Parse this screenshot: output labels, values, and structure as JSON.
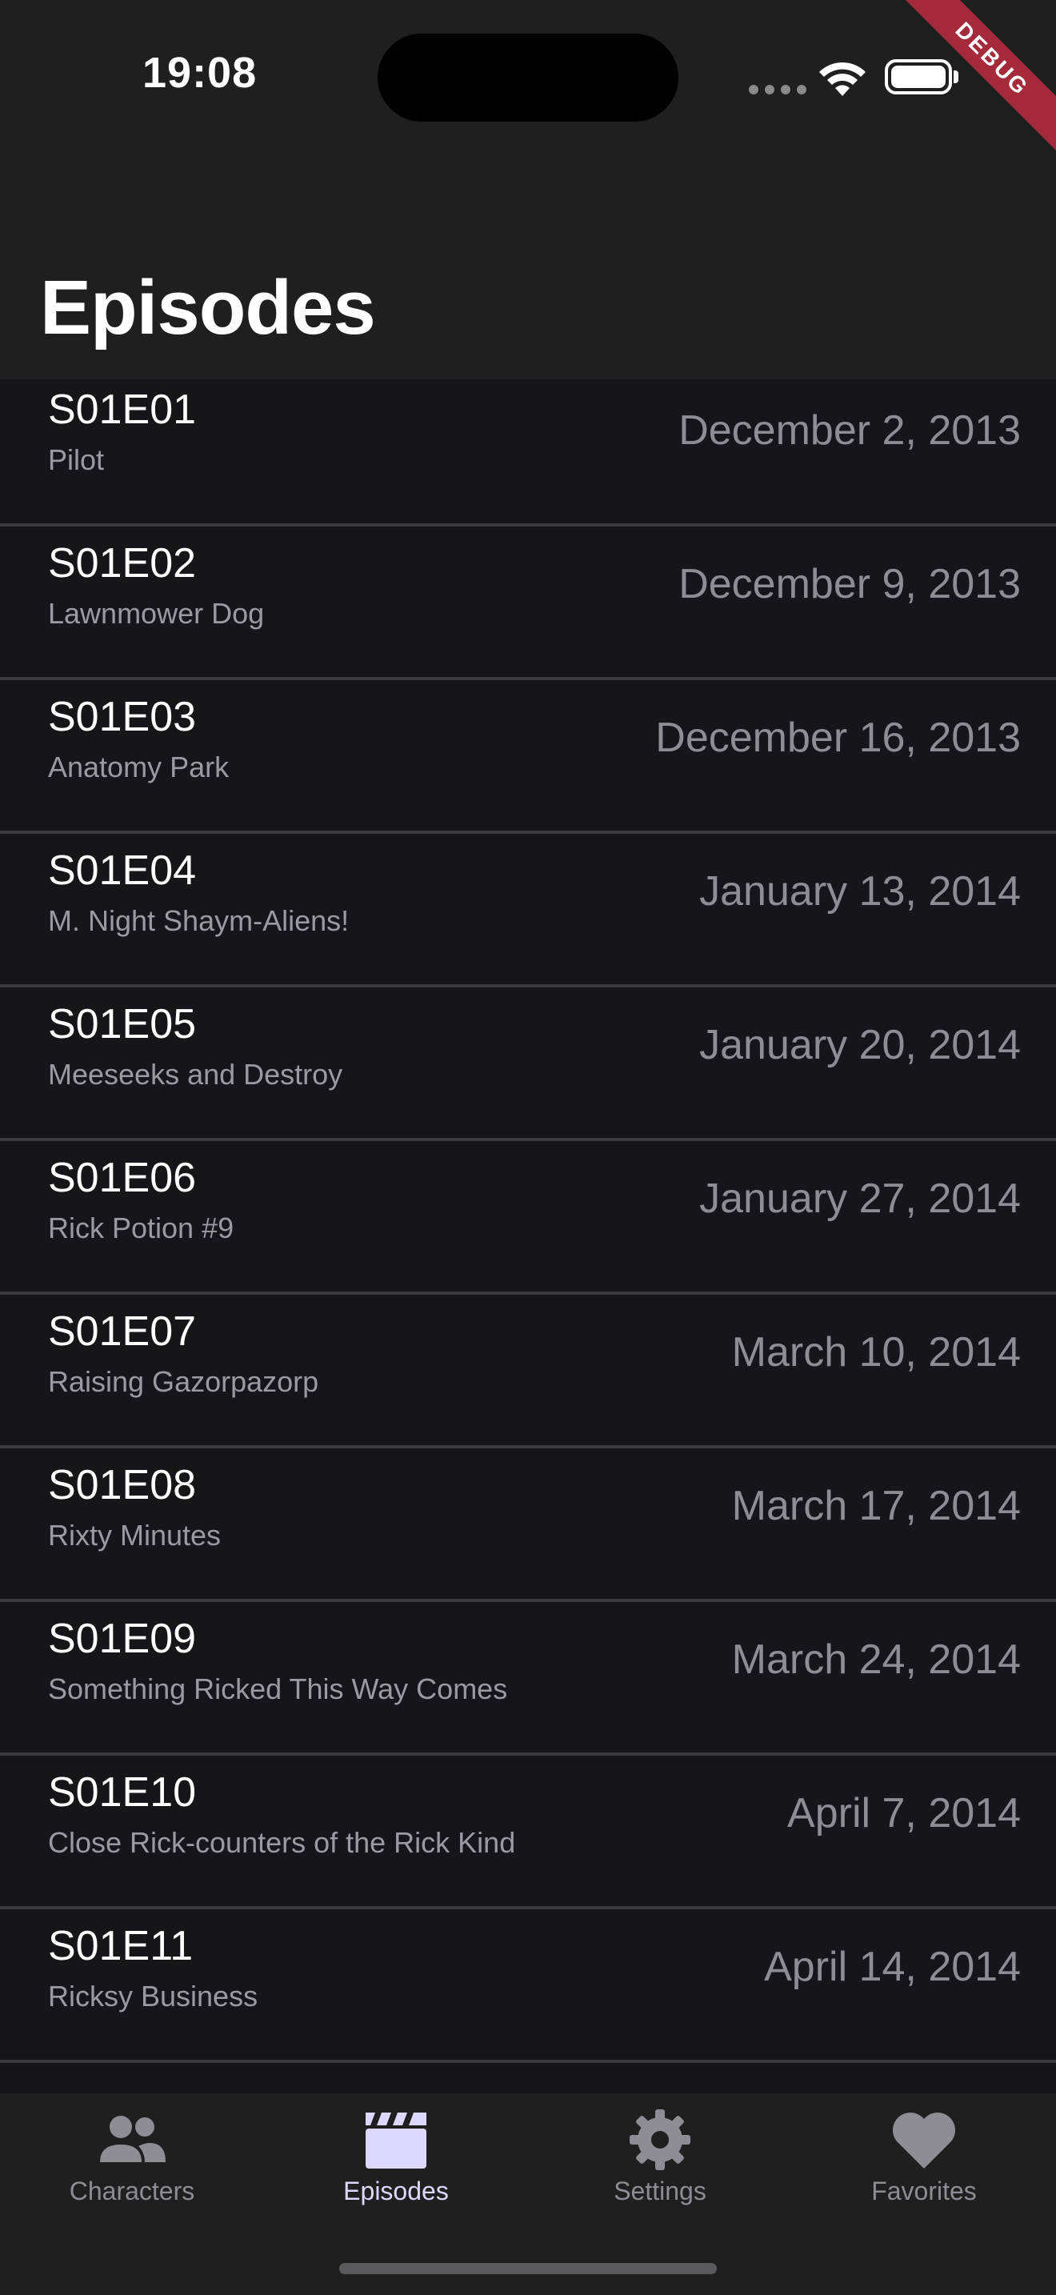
{
  "status_bar": {
    "time": "19:08"
  },
  "debug_banner": "DEBUG",
  "header": {
    "title": "Episodes"
  },
  "episodes": [
    {
      "code": "S01E01",
      "name": "Pilot",
      "date": "December 2, 2013"
    },
    {
      "code": "S01E02",
      "name": "Lawnmower Dog",
      "date": "December 9, 2013"
    },
    {
      "code": "S01E03",
      "name": "Anatomy Park",
      "date": "December 16, 2013"
    },
    {
      "code": "S01E04",
      "name": "M. Night Shaym-Aliens!",
      "date": "January 13, 2014"
    },
    {
      "code": "S01E05",
      "name": "Meeseeks and Destroy",
      "date": "January 20, 2014"
    },
    {
      "code": "S01E06",
      "name": "Rick Potion #9",
      "date": "January 27, 2014"
    },
    {
      "code": "S01E07",
      "name": "Raising Gazorpazorp",
      "date": "March 10, 2014"
    },
    {
      "code": "S01E08",
      "name": "Rixty Minutes",
      "date": "March 17, 2014"
    },
    {
      "code": "S01E09",
      "name": "Something Ricked This Way Comes",
      "date": "March 24, 2014"
    },
    {
      "code": "S01E10",
      "name": "Close Rick-counters of the Rick Kind",
      "date": "April 7, 2014"
    },
    {
      "code": "S01E11",
      "name": "Ricksy Business",
      "date": "April 14, 2014"
    }
  ],
  "tabs": [
    {
      "label": "Characters",
      "icon": "people-icon",
      "active": false
    },
    {
      "label": "Episodes",
      "icon": "clapperboard-icon",
      "active": true
    },
    {
      "label": "Settings",
      "icon": "gear-icon",
      "active": false
    },
    {
      "label": "Favorites",
      "icon": "heart-icon",
      "active": false
    }
  ],
  "colors": {
    "accent": "#ddd8ff",
    "background": "#16151a",
    "bar": "#1f1f1f",
    "debug": "#a52a3a"
  }
}
